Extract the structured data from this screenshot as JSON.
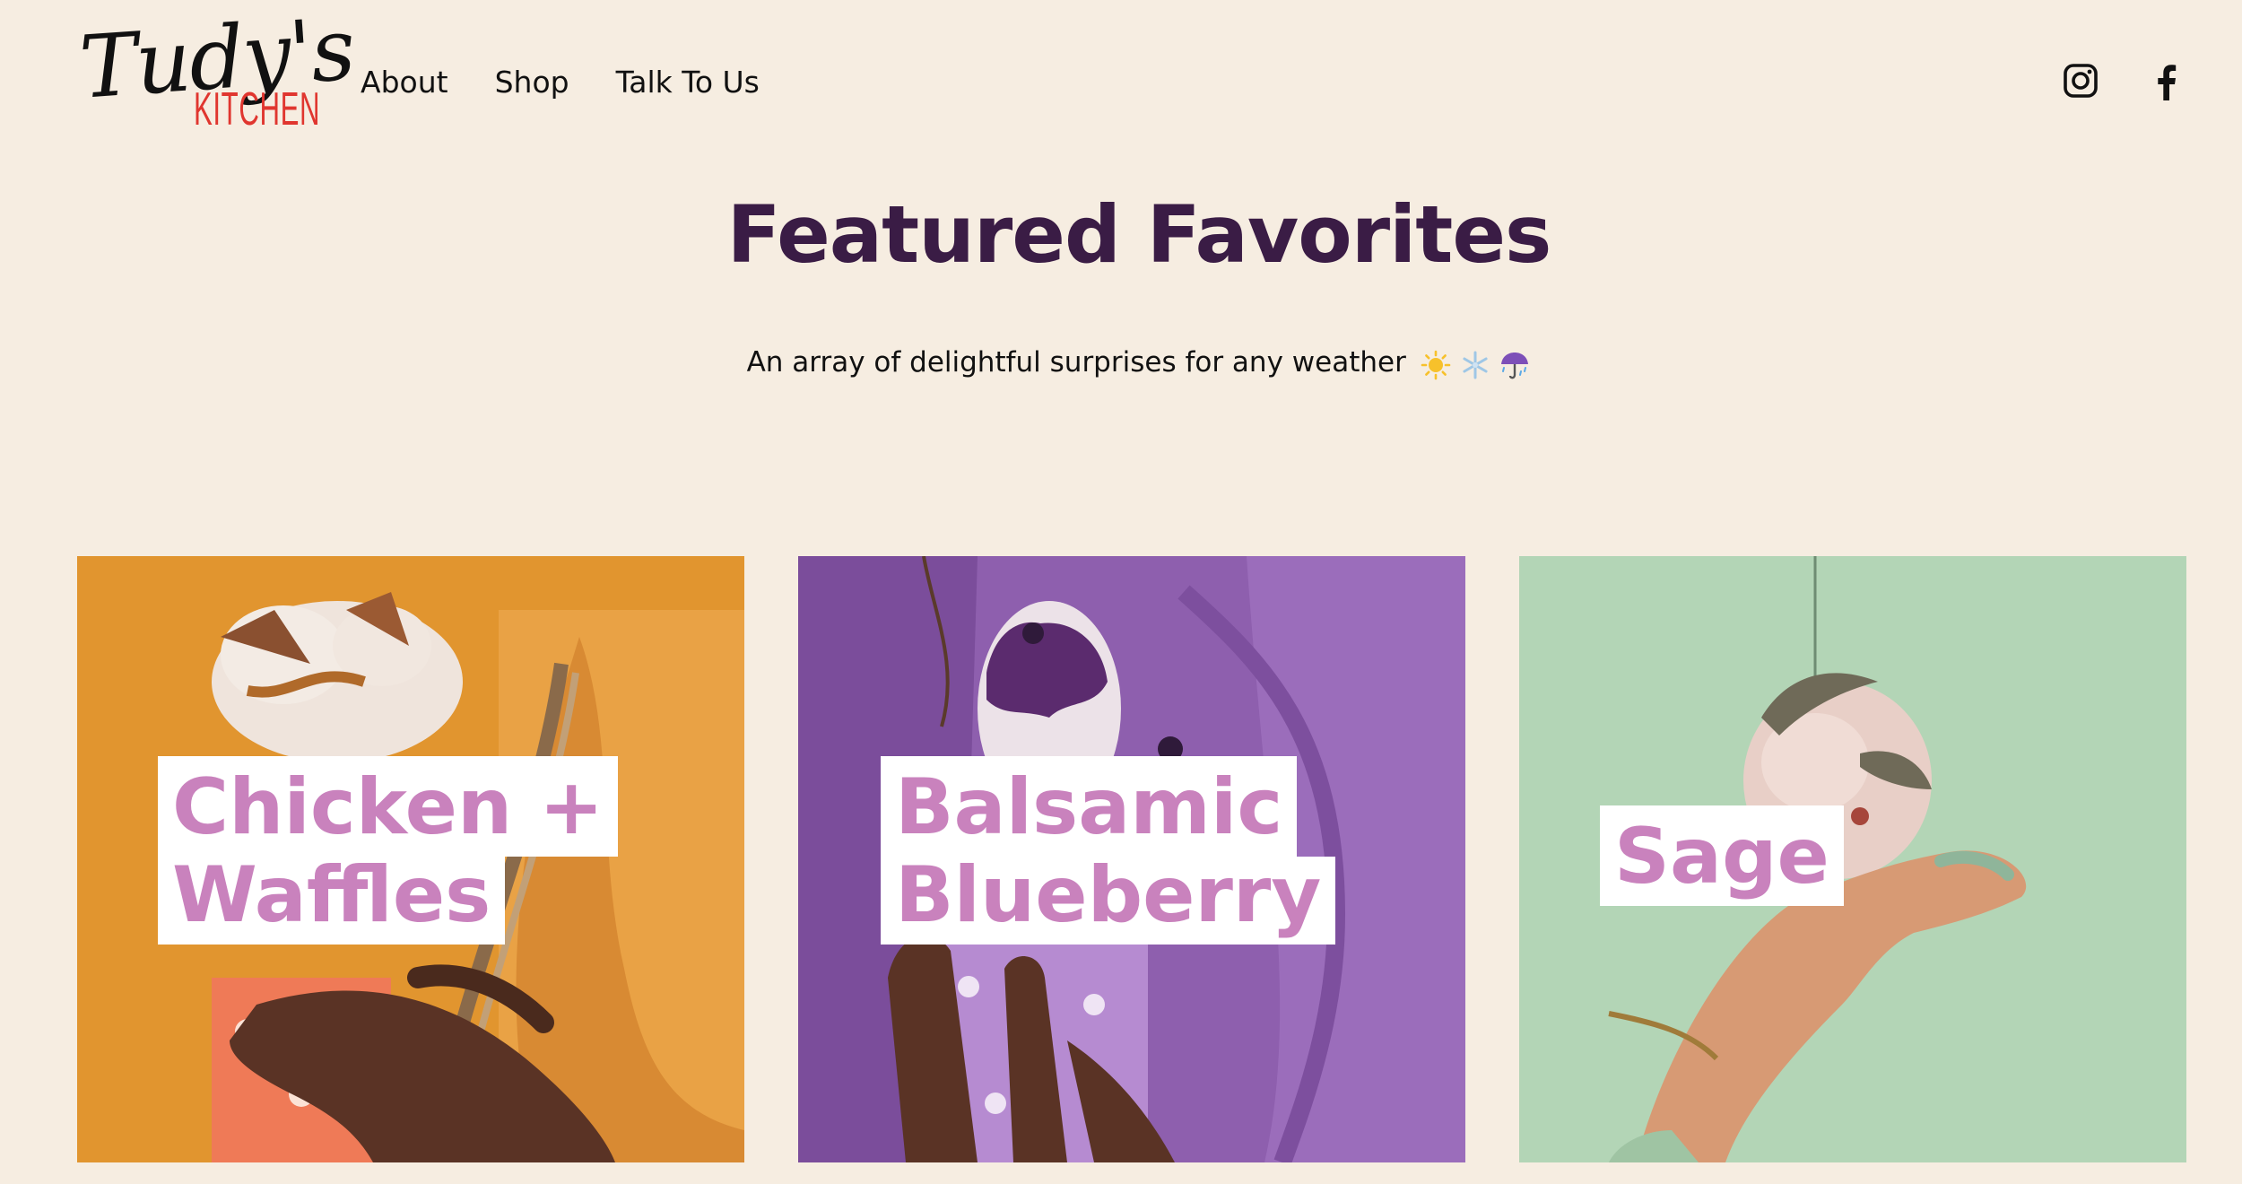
{
  "brand": {
    "logo_script": "Tudy's",
    "logo_sub": "KITCHEN",
    "accent": "#e0362f"
  },
  "nav": {
    "items": [
      "About",
      "Shop",
      "Talk To Us"
    ]
  },
  "social": {
    "icons": [
      "instagram-icon",
      "facebook-icon"
    ]
  },
  "hero": {
    "title": "Featured Favorites",
    "subtitle": "An array of delightful surprises for any weather",
    "weather_icons": [
      "sun-icon",
      "snowflake-icon",
      "umbrella-rain-icon"
    ],
    "title_color": "#3a1c45"
  },
  "cards": [
    {
      "line1": "Chicken +",
      "line2": "Waffles",
      "bg": "#e1952f"
    },
    {
      "line1": "Balsamic",
      "line2": "Blueberry",
      "bg": "#8e5fae"
    },
    {
      "line1": "Sage",
      "line2": "",
      "bg": "#b3d5b6"
    }
  ],
  "colors": {
    "page_bg": "#f6ede1",
    "label_text": "#c982bd",
    "label_bg": "#ffffff"
  }
}
